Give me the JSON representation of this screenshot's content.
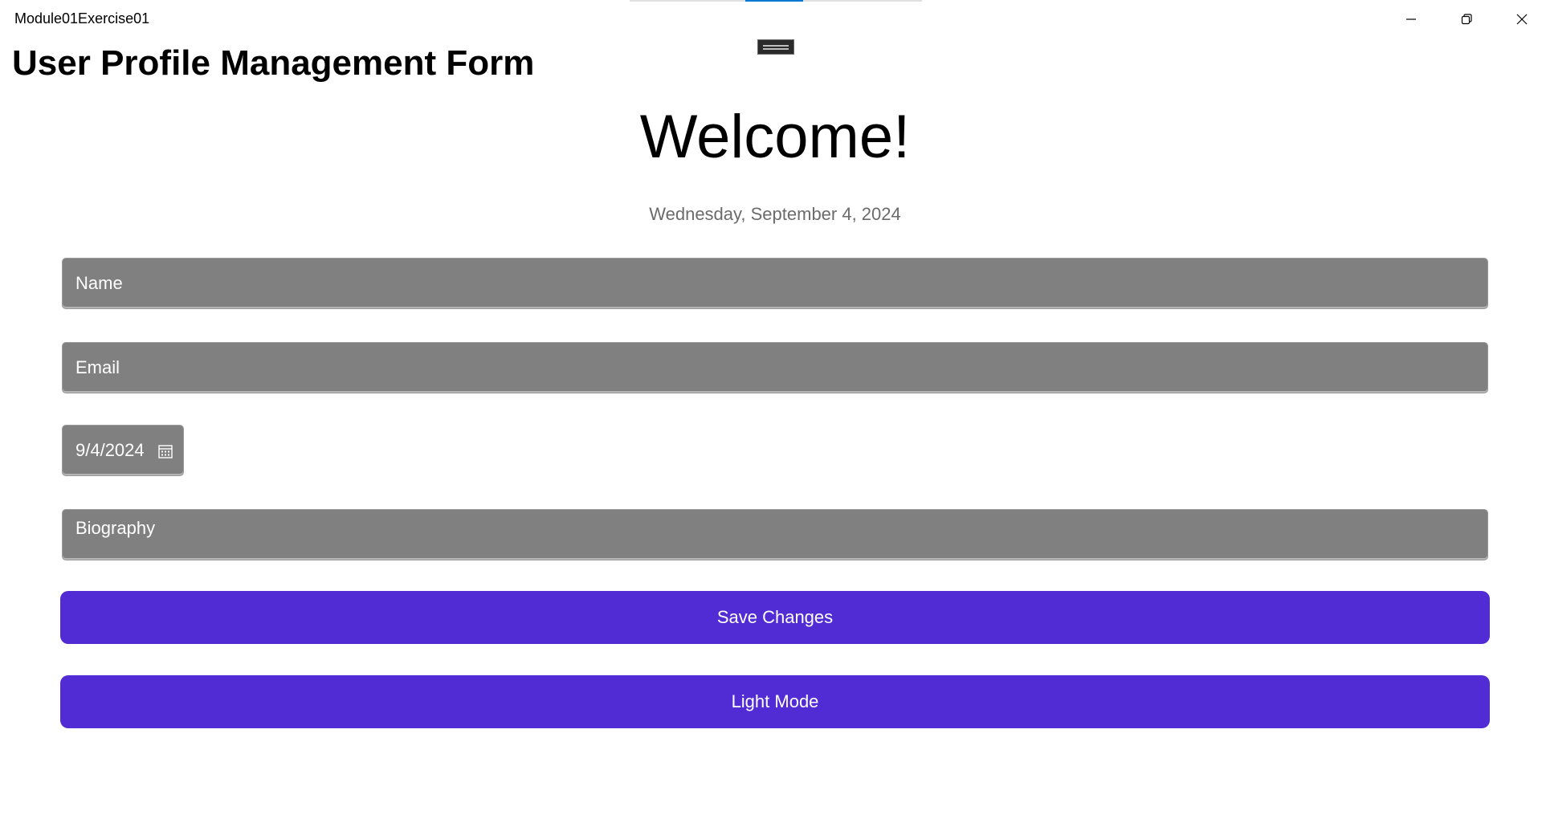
{
  "window": {
    "title": "Module01Exercise01",
    "icons": {
      "minimize": "minimize-icon",
      "maximize": "restore-icon",
      "close": "close-icon"
    }
  },
  "page": {
    "title": "User Profile Management Form",
    "welcome": "Welcome!",
    "date": "Wednesday, September 4, 2024"
  },
  "form": {
    "name_placeholder": "Name",
    "email_placeholder": "Email",
    "birthdate_value": "9/4/2024",
    "bio_placeholder": "Biography"
  },
  "buttons": {
    "save_label": "Save Changes",
    "theme_label": "Light Mode"
  },
  "colors": {
    "accent": "#512bd4",
    "field_background": "#808080",
    "title_bar_indicator": "#0078d4"
  }
}
